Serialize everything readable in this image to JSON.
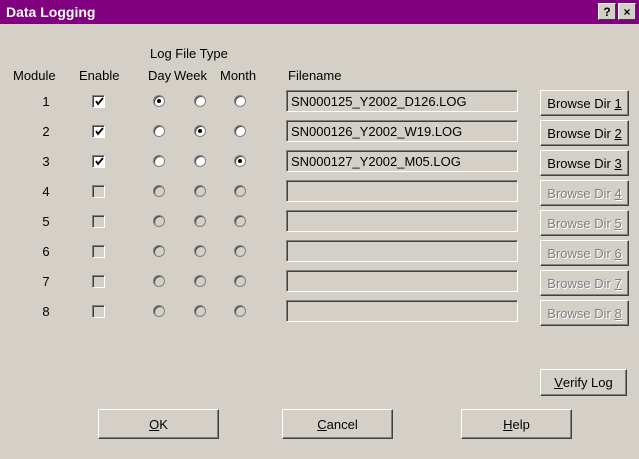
{
  "window": {
    "title": "Data Logging",
    "help_glyph": "?",
    "close_glyph": "×"
  },
  "headers": {
    "log_file_type": "Log File Type",
    "module": "Module",
    "enable": "Enable",
    "day": "Day",
    "week": "Week",
    "month": "Month",
    "filename": "Filename"
  },
  "rows": [
    {
      "module": "1",
      "enabled": true,
      "type": "day",
      "filename": "SN000125_Y2002_D126.LOG",
      "browse_prefix": "Browse Dir ",
      "browse_key": "1",
      "browse_enabled": true
    },
    {
      "module": "2",
      "enabled": true,
      "type": "week",
      "filename": "SN000126_Y2002_W19.LOG",
      "browse_prefix": "Browse Dir ",
      "browse_key": "2",
      "browse_enabled": true
    },
    {
      "module": "3",
      "enabled": true,
      "type": "month",
      "filename": "SN000127_Y2002_M05.LOG",
      "browse_prefix": "Browse Dir ",
      "browse_key": "3",
      "browse_enabled": true
    },
    {
      "module": "4",
      "enabled": false,
      "type": "",
      "filename": "",
      "browse_prefix": "Browse Dir ",
      "browse_key": "4",
      "browse_enabled": false
    },
    {
      "module": "5",
      "enabled": false,
      "type": "",
      "filename": "",
      "browse_prefix": "Browse Dir ",
      "browse_key": "5",
      "browse_enabled": false
    },
    {
      "module": "6",
      "enabled": false,
      "type": "",
      "filename": "",
      "browse_prefix": "Browse Dir ",
      "browse_key": "6",
      "browse_enabled": false
    },
    {
      "module": "7",
      "enabled": false,
      "type": "",
      "filename": "",
      "browse_prefix": "Browse Dir ",
      "browse_key": "7",
      "browse_enabled": false
    },
    {
      "module": "8",
      "enabled": false,
      "type": "",
      "filename": "",
      "browse_prefix": "Browse Dir ",
      "browse_key": "8",
      "browse_enabled": false
    }
  ],
  "buttons": {
    "verify_key": "V",
    "verify_rest": "erify Log",
    "ok_key": "O",
    "ok_rest": "K",
    "cancel_key": "C",
    "cancel_rest": "ancel",
    "help_key": "H",
    "help_rest": "elp"
  },
  "colors": {
    "title_bar": "#800080",
    "face": "#d4d0c8"
  }
}
